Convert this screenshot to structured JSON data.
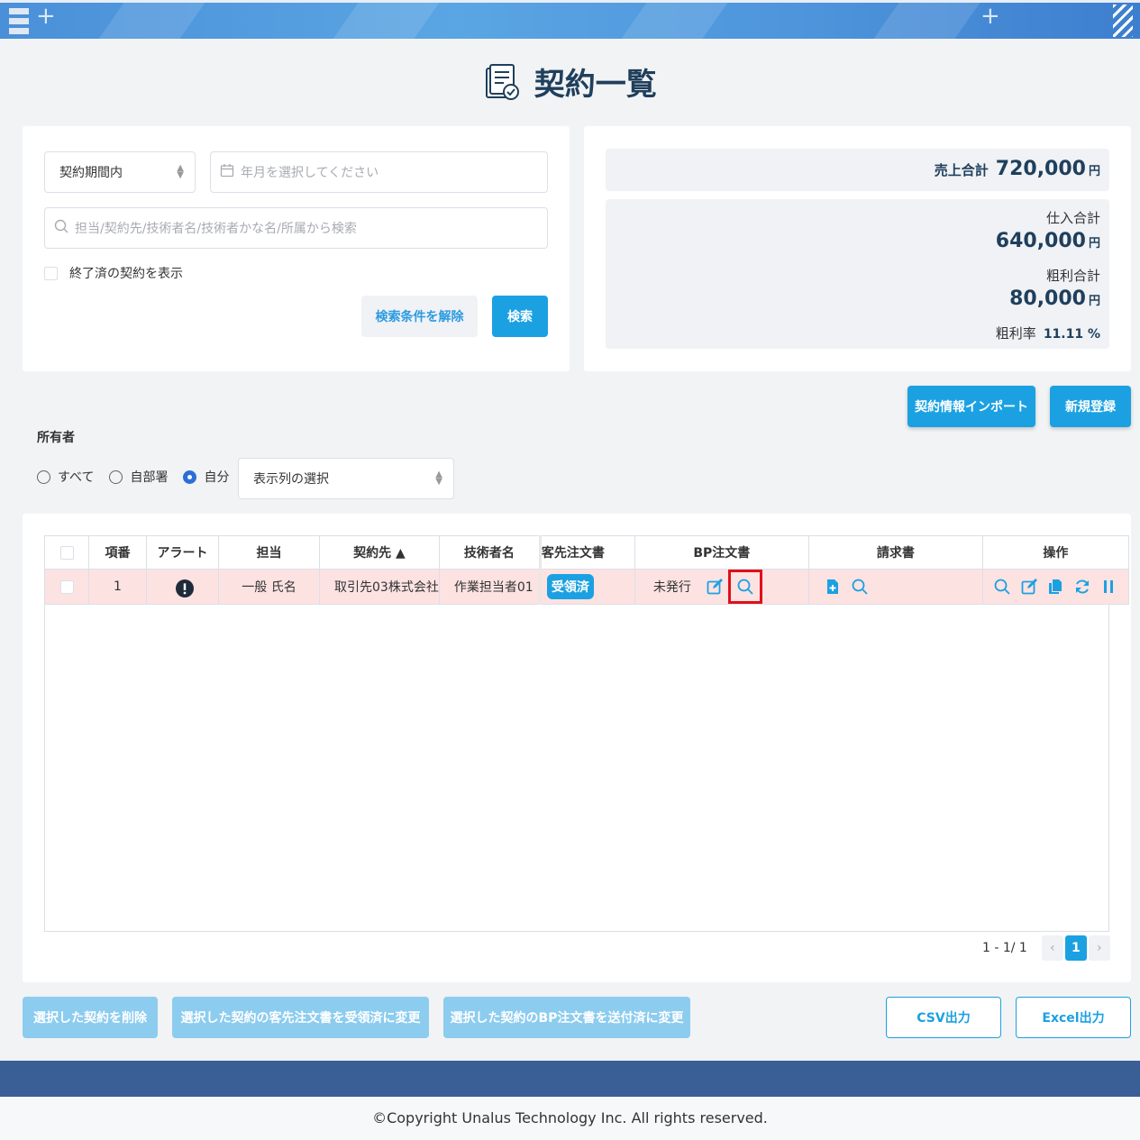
{
  "page": {
    "title": "契約一覧",
    "copyright": "©Copyright Unalus Technology Inc. All rights reserved."
  },
  "search": {
    "period_select": "契約期間内",
    "month_placeholder": "年月を選択してください",
    "keyword_placeholder": "担当/契約先/技術者名/技術者かな名/所属から検索",
    "show_finished_label": "終了済の契約を表示",
    "clear_button": "検索条件を解除",
    "search_button": "検索"
  },
  "summary": {
    "sales_label": "売上合計",
    "sales_value": "720,000",
    "sales_unit": "円",
    "purchase_label": "仕入合計",
    "purchase_value": "640,000",
    "purchase_unit": "円",
    "profit_label": "粗利合計",
    "profit_value": "80,000",
    "profit_unit": "円",
    "margin_label": "粗利率",
    "margin_value": "11.11 %"
  },
  "actions": {
    "import_button": "契約情報インポート",
    "new_button": "新規登録"
  },
  "owner": {
    "label": "所有者",
    "options": [
      "すべて",
      "自部署",
      "自分"
    ],
    "selected": "自分",
    "columns_select": "表示列の選択"
  },
  "table": {
    "headers": [
      "項番",
      "アラート",
      "担当",
      "契約先 ▲",
      "技術者名",
      "客先注文書",
      "BP注文書",
      "請求書",
      "操作"
    ],
    "rows": [
      {
        "no": "1",
        "alert": "!",
        "owner": "一般 氏名",
        "client": "取引先03株式会社",
        "engineer": "作業担当者01",
        "customer_order": "受領済",
        "bp_order": "未発行"
      }
    ]
  },
  "pagination": {
    "range": "1 - 1/ 1",
    "prev": "‹",
    "current": "1",
    "next": "›"
  },
  "bottom_buttons": {
    "delete": "選択した契約を削除",
    "mark_received": "選択した契約の客先注文書を受領済に変更",
    "mark_sent": "選択した契約のBP注文書を送付済に変更",
    "csv": "CSV出力",
    "excel": "Excel出力"
  },
  "colors": {
    "primary": "#1ba1e2",
    "title": "#1f3f5c",
    "row_alert": "#fde2e2",
    "highlight": "#e0101a",
    "footer_band": "#3a5f97"
  },
  "icons": [
    "menu-icon",
    "contract-list-icon",
    "calendar-icon",
    "search-icon",
    "alert-icon",
    "edit-icon",
    "search-icon",
    "add-document-icon",
    "search-icon",
    "view-icon",
    "edit-icon",
    "copy-icon",
    "refresh-icon",
    "pause-icon"
  ]
}
